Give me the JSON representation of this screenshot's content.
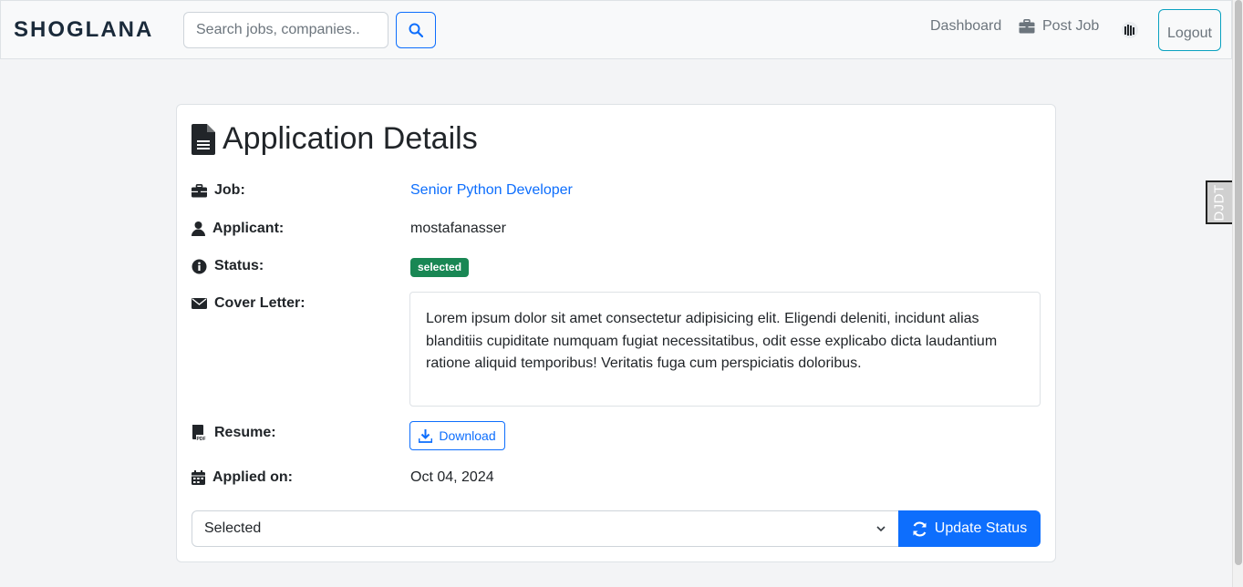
{
  "navbar": {
    "brand": "SHOGLANA",
    "search_placeholder": "Search jobs, companies..",
    "dashboard_label": "Dashboard",
    "post_job_label": "Post Job",
    "logout_label": "Logout"
  },
  "djdt_label": "DJDT",
  "card": {
    "title": "Application Details",
    "job_label": "Job:",
    "job_value": "Senior Python Developer",
    "applicant_label": "Applicant:",
    "applicant_value": "mostafanasser",
    "status_label": "Status:",
    "status_value": "selected",
    "cover_label": "Cover Letter:",
    "cover_text": "Lorem ipsum dolor sit amet consectetur adipisicing elit. Eligendi deleniti, incidunt alias blanditiis cupiditate numquam fugiat necessitatibus, odit esse explicabo dicta laudantium ratione aliquid temporibus! Veritatis fuga cum perspiciatis doloribus.",
    "resume_label": "Resume:",
    "download_label": "Download",
    "applied_label": "Applied on:",
    "applied_value": "Oct 04, 2024",
    "status_select_value": "Selected",
    "update_label": "Update Status"
  },
  "colors": {
    "primary": "#0d6efd",
    "success": "#198754",
    "info": "#0aa2c0"
  },
  "icons": [
    "search-icon",
    "briefcase-icon",
    "brand-logo-icon",
    "file-icon",
    "user-icon",
    "info-icon",
    "envelope-icon",
    "pdf-file-icon",
    "calendar-icon",
    "download-icon",
    "refresh-icon",
    "chevron-down-icon"
  ]
}
